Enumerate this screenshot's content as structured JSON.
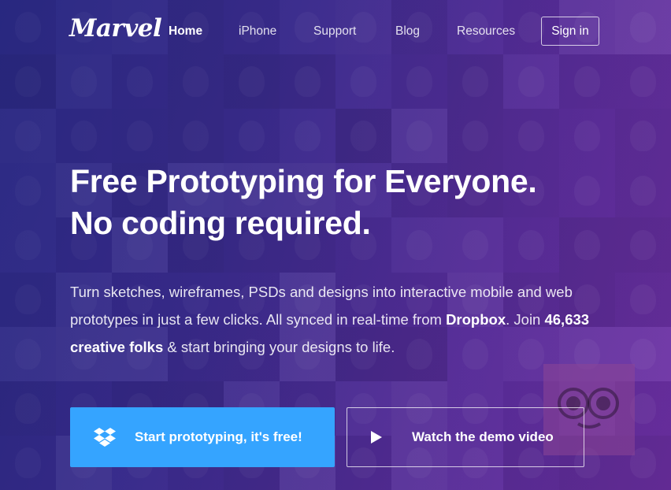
{
  "nav": {
    "logo": "Marvel",
    "links": [
      {
        "label": "Home",
        "active": true
      },
      {
        "label": "iPhone",
        "active": false
      },
      {
        "label": "Support",
        "active": false
      },
      {
        "label": "Blog",
        "active": false
      },
      {
        "label": "Resources",
        "active": false
      }
    ],
    "signin_label": "Sign in"
  },
  "hero": {
    "headline_line1": "Free Prototyping for Everyone.",
    "headline_line2": "No coding required.",
    "sub_part1": "Turn sketches, wireframes, PSDs and designs into interactive mobile and web prototypes in just a few clicks. All synced in real-time from ",
    "sub_dropbox": "Dropbox",
    "sub_part2": ". Join ",
    "sub_count": "46,633 creative folks",
    "sub_part3": " & start bringing your designs to life."
  },
  "cta": {
    "primary_label": "Start prototyping, it's free!",
    "primary_icon": "dropbox-icon",
    "secondary_label": "Watch the demo video",
    "secondary_icon": "play-icon"
  },
  "colors": {
    "primary_button": "#35a4ff",
    "background_start": "#2c2f86",
    "background_end": "#6e2fa3"
  }
}
